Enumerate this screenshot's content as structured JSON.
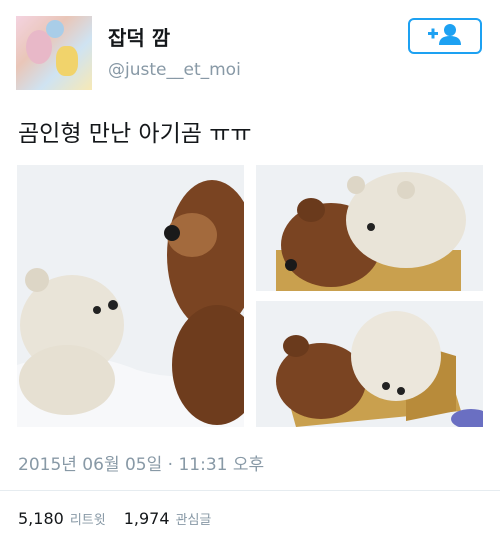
{
  "user": {
    "display_name": "잡덕 깜",
    "handle": "@juste__et_moi"
  },
  "follow_button": {
    "icon": "add-user-icon",
    "color": "#1da1f2"
  },
  "tweet": {
    "text": "곰인형 만난 아기곰 ㅠㅠ",
    "timestamp": "2015년 06월 05일 · 11:31 오후"
  },
  "stats": [
    {
      "value": "5,180",
      "label": "리트윗"
    },
    {
      "value": "1,974",
      "label": "관심글"
    }
  ],
  "photos": [
    {
      "subject": "polar-bear-cub-facing-teddy-bear"
    },
    {
      "subject": "polar-bear-cub-hugging-teddy-bear"
    },
    {
      "subject": "polar-bear-cub-in-box-with-teddy-bear"
    }
  ]
}
